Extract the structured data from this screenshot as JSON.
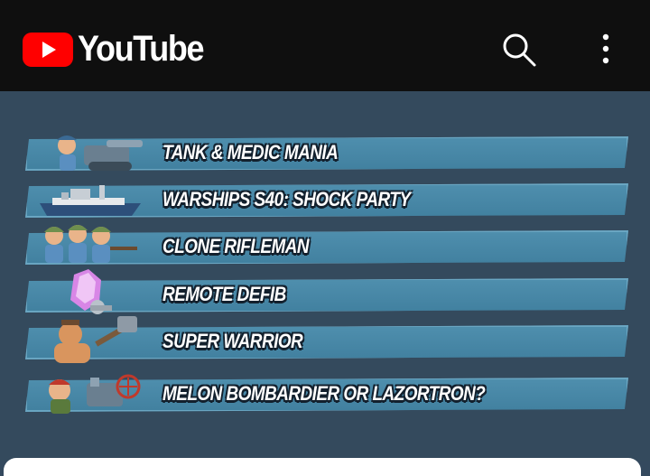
{
  "app": {
    "name": "YouTube",
    "brand_color": "#ff0000",
    "header_bg": "#0f0f0f"
  },
  "header": {
    "search_icon": "search-icon",
    "more_icon": "more-vertical-icon"
  },
  "video": {
    "background": "#344a5d",
    "banners": [
      {
        "label": "TANK & MEDIC MANIA",
        "icon": "tank-and-medic-icon"
      },
      {
        "label": "WARSHIPS S40: SHOCK PARTY",
        "icon": "warship-icon"
      },
      {
        "label": "CLONE RIFLEMAN",
        "icon": "riflemen-icon"
      },
      {
        "label": "REMOTE DEFIB",
        "icon": "crystal-icon"
      },
      {
        "label": "SUPER WARRIOR",
        "icon": "warrior-icon"
      },
      {
        "label": "MELON BOMBARDIER OR LAZORTRON?",
        "icon": "bombardier-icon"
      }
    ]
  }
}
